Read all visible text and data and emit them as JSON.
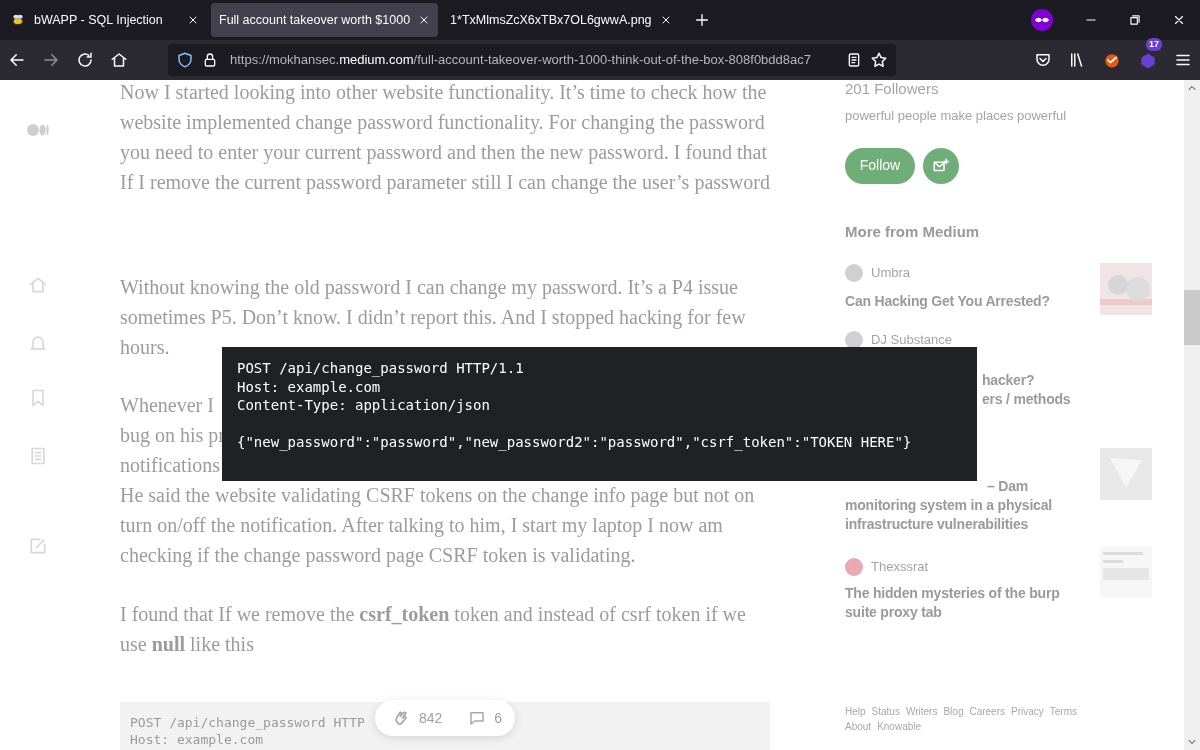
{
  "tabs": [
    {
      "title": "bWAPP - SQL Injection",
      "selected": false
    },
    {
      "title": "Full account takeover worth $1000",
      "selected": true
    },
    {
      "title": "1*TxMlmsZcX6xTBx7OL6gwwA.png",
      "selected": false
    }
  ],
  "address": {
    "prefix": "https://mokhansec.",
    "domain": "medium.com",
    "path": "/full-account-takeover-worth-1000-think-out-of-the-box-808f0bdd8ac7"
  },
  "extension_badge": "17",
  "article": [
    {
      "kind": "paragraph",
      "text": "Now I started looking into other website functionality. It’s time to check how the website implemented change password functionality. For changing the password you need to enter your current password and then the new password. I found that If I remove the current password parameter still I can change the user’s password"
    },
    {
      "kind": "paragraph",
      "text": "Without knowing the old password I can change my password. It’s a P4 issue sometimes P5. Don’t know. I didn’t report this. And I stopped hacking for few hours."
    },
    {
      "kind": "lines",
      "lines": [
        "Whenever I",
        "bug on his pr",
        "notifications",
        "He said the website validating CSRF tokens on the change info page but not on",
        "turn on/off the notification. After talking to him, I start my laptop I now am",
        "checking if the change password page CSRF token is validating."
      ]
    },
    {
      "kind": "paragraph",
      "text": "I found that If we remove the **csrf_token** token and instead of csrf token if we use **null** like this"
    },
    {
      "kind": "code",
      "lines": [
        "POST /api/change_password HTTP",
        "Host: example.com"
      ]
    }
  ],
  "sidebar": {
    "followers": "201 Followers",
    "bio": "powerful people make places powerful",
    "follow_button": "Follow",
    "section_title": "More from Medium",
    "stories": [
      {
        "author": "Umbra",
        "title": "Can Hacking Get You Arrested?",
        "thumb": true
      },
      {
        "author": "DJ Substance",
        "title_lines": [
          "hacker?",
          "ers / methods"
        ],
        "thumb": false
      },
      {
        "title_lines": [
          "– Dam",
          "monitoring system in a physical",
          "infrastructure vulnerabilities"
        ],
        "thumb": true
      },
      {
        "author": "Thexssrat",
        "title": "The hidden mysteries of the burp suite proxy tab",
        "thumb": true
      }
    ],
    "footer": [
      "Help",
      "Status",
      "Writers",
      "Blog",
      "Careers",
      "Privacy",
      "Terms",
      "About",
      "Knowable"
    ]
  },
  "claps": {
    "count": "842",
    "comments": "6"
  },
  "overlay": {
    "header": [
      "POST /api/change_password HTTP/1.1",
      "Host: example.com",
      "Content-Type: application/json"
    ],
    "body": "{\"new_password\":\"password\",\"new_password2\":\"password\",\"csrf_token\":\"TOKEN HERE\"}"
  }
}
